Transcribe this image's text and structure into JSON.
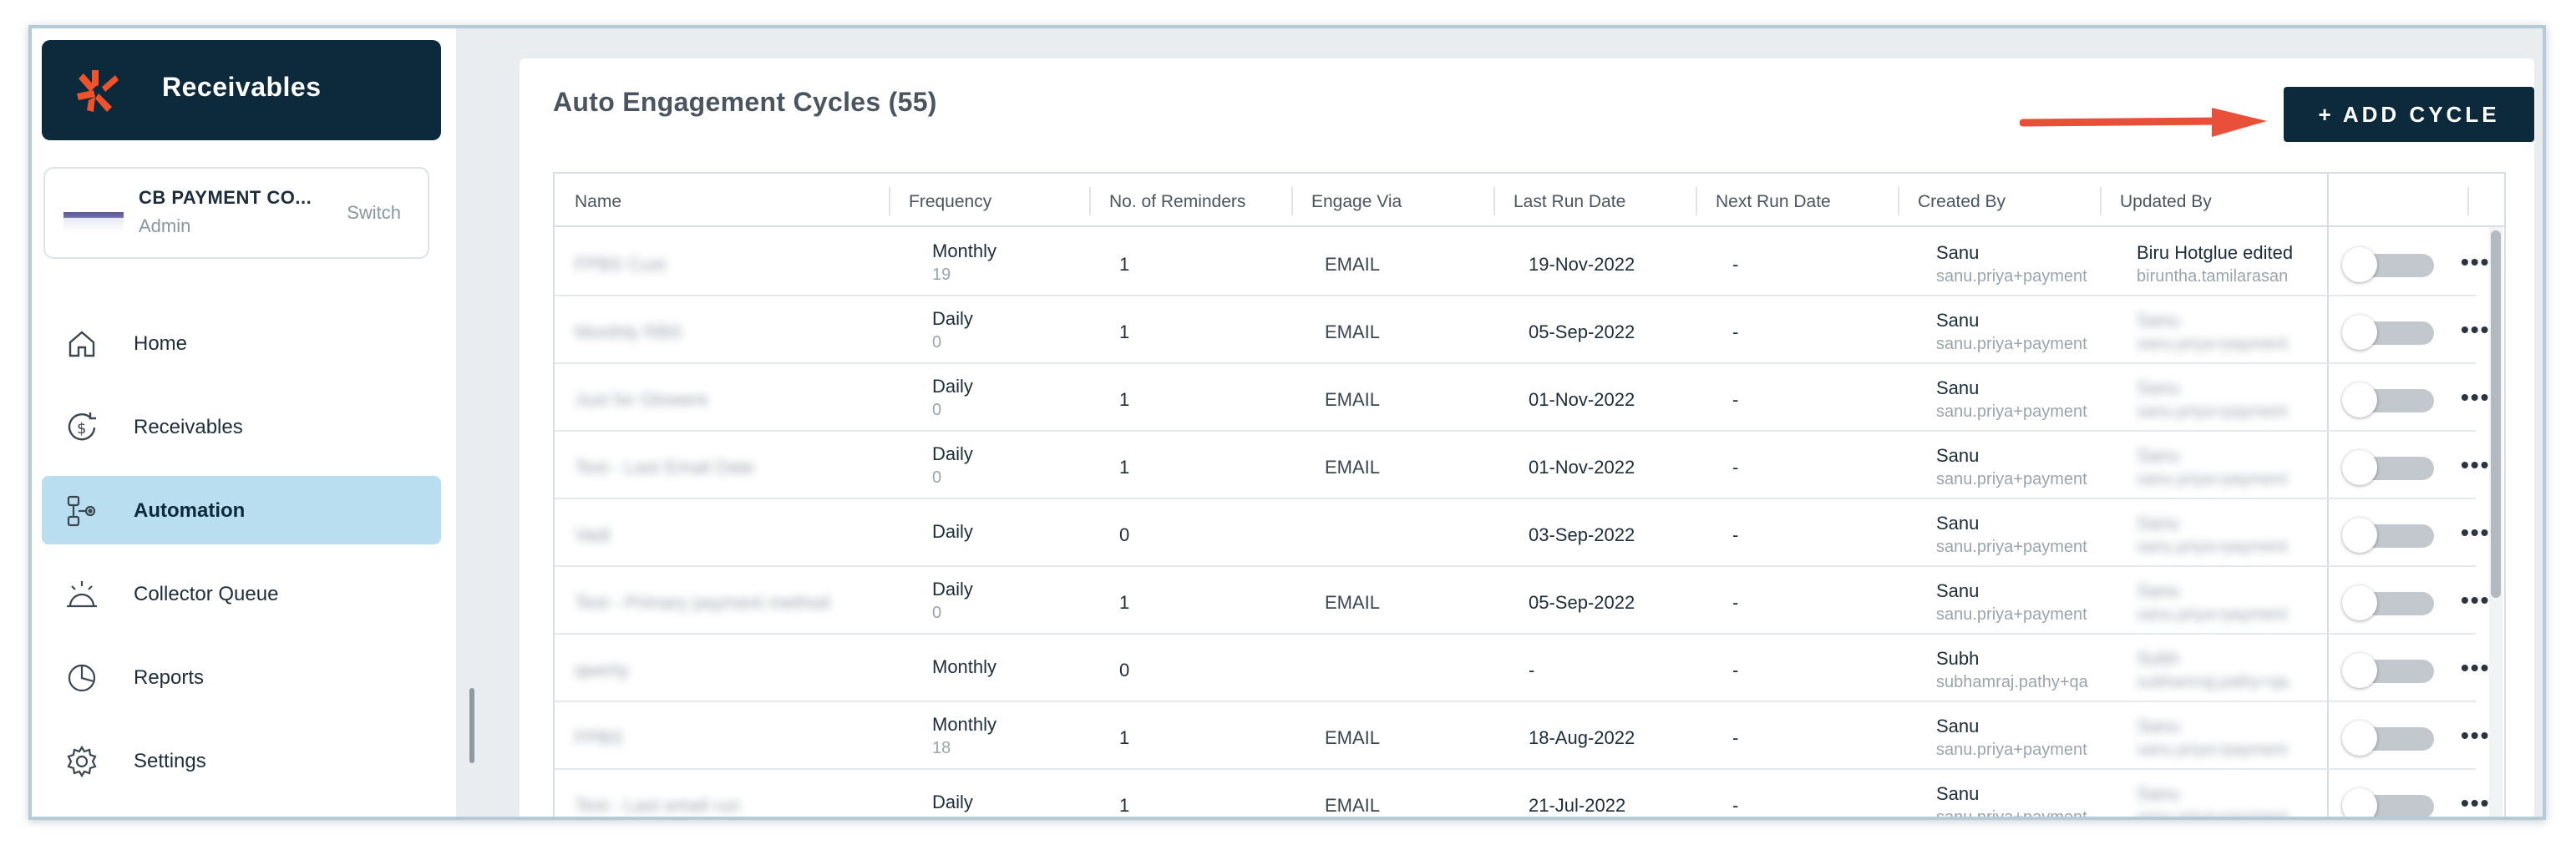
{
  "sidebar": {
    "brand": "Receivables",
    "account": {
      "name": "CB PAYMENT CO...",
      "role": "Admin",
      "switch_label": "Switch"
    },
    "nav": [
      {
        "label": "Home",
        "icon": "home-icon"
      },
      {
        "label": "Receivables",
        "icon": "dollar-refresh-icon"
      },
      {
        "label": "Automation",
        "icon": "automation-icon",
        "active": true
      },
      {
        "label": "Collector Queue",
        "icon": "bell-icon"
      },
      {
        "label": "Reports",
        "icon": "pie-chart-icon"
      },
      {
        "label": "Settings",
        "icon": "gear-icon"
      }
    ]
  },
  "main": {
    "title": "Auto Engagement Cycles (55)",
    "add_button": "+ ADD CYCLE",
    "columns": [
      "Name",
      "Frequency",
      "No. of Reminders",
      "Engage Via",
      "Last Run Date",
      "Next Run Date",
      "Created By",
      "Updated By"
    ],
    "rows": [
      {
        "name": "FPBS Cust",
        "frequency": "Monthly",
        "frequency_sub": "19",
        "reminders": "1",
        "engage": "EMAIL",
        "last_run": "19-Nov-2022",
        "next_run": "-",
        "created_by": "Sanu",
        "created_email": "sanu.priya+payment",
        "updated_by": "Biru Hotglue edited",
        "updated_email": "biruntha.tamilarasan",
        "updated_blur": false
      },
      {
        "name": "Monthly RBS",
        "frequency": "Daily",
        "frequency_sub": "0",
        "reminders": "1",
        "engage": "EMAIL",
        "last_run": "05-Sep-2022",
        "next_run": "-",
        "created_by": "Sanu",
        "created_email": "sanu.priya+payment",
        "updated_by": "Sanu",
        "updated_email": "sanu.priya+payment",
        "updated_blur": true
      },
      {
        "name": "Just for Glowere",
        "frequency": "Daily",
        "frequency_sub": "0",
        "reminders": "1",
        "engage": "EMAIL",
        "last_run": "01-Nov-2022",
        "next_run": "-",
        "created_by": "Sanu",
        "created_email": "sanu.priya+payment",
        "updated_by": "Sanu",
        "updated_email": "sanu.priya+payment",
        "updated_blur": true
      },
      {
        "name": "Test - Last Email Date",
        "frequency": "Daily",
        "frequency_sub": "0",
        "reminders": "1",
        "engage": "EMAIL",
        "last_run": "01-Nov-2022",
        "next_run": "-",
        "created_by": "Sanu",
        "created_email": "sanu.priya+payment",
        "updated_by": "Sanu",
        "updated_email": "sanu.priya+payment",
        "updated_blur": true
      },
      {
        "name": "Vadi",
        "frequency": "Daily",
        "frequency_sub": "",
        "reminders": "0",
        "engage": "",
        "last_run": "03-Sep-2022",
        "next_run": "-",
        "created_by": "Sanu",
        "created_email": "sanu.priya+payment",
        "updated_by": "Sanu",
        "updated_email": "sanu.priya+payment",
        "updated_blur": true
      },
      {
        "name": "Test - Primary payment method",
        "frequency": "Daily",
        "frequency_sub": "0",
        "reminders": "1",
        "engage": "EMAIL",
        "last_run": "05-Sep-2022",
        "next_run": "-",
        "created_by": "Sanu",
        "created_email": "sanu.priya+payment",
        "updated_by": "Sanu",
        "updated_email": "sanu.priya+payment",
        "updated_blur": true
      },
      {
        "name": "qwerty",
        "frequency": "Monthly",
        "frequency_sub": "",
        "reminders": "0",
        "engage": "",
        "last_run": "-",
        "next_run": "-",
        "created_by": "Subh",
        "created_email": "subhamraj.pathy+qa",
        "updated_by": "Subh",
        "updated_email": "subhamraj.pathy+qa",
        "updated_blur": true
      },
      {
        "name": "FPBS",
        "frequency": "Monthly",
        "frequency_sub": "18",
        "reminders": "1",
        "engage": "EMAIL",
        "last_run": "18-Aug-2022",
        "next_run": "-",
        "created_by": "Sanu",
        "created_email": "sanu.priya+payment",
        "updated_by": "Sanu",
        "updated_email": "sanu.priya+payment",
        "updated_blur": true
      },
      {
        "name": "Test - Last email run",
        "frequency": "Daily",
        "frequency_sub": "",
        "reminders": "1",
        "engage": "EMAIL",
        "last_run": "21-Jul-2022",
        "next_run": "-",
        "created_by": "Sanu",
        "created_email": "sanu.priya+payment",
        "updated_by": "Sanu",
        "updated_email": "sanu.priya+payment",
        "updated_blur": true
      }
    ]
  },
  "colors": {
    "navy": "#0d2a3c",
    "active_nav": "#b9def0",
    "arrow": "#e8503a",
    "brand_logo": "#f0532c"
  }
}
